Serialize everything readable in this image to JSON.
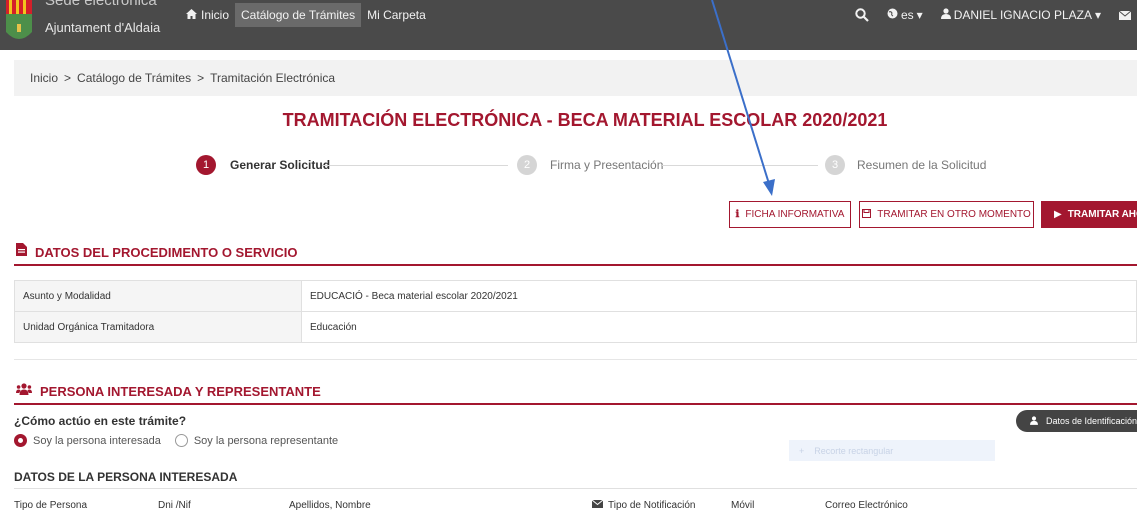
{
  "app": {
    "title": "Sede electrónica",
    "subtitle": "Ajuntament d'Aldaia"
  },
  "nav": {
    "links": [
      "Inicio",
      "Catálogo de Trámites",
      "Mi Carpeta"
    ],
    "language": "es",
    "user": "DANIEL IGNACIO PLAZA"
  },
  "breadcrumb": [
    "Inicio",
    ">",
    "Catálogo de Trámites",
    ">",
    "Tramitación Electrónica"
  ],
  "page_title": "TRAMITACIÓN ELECTRÓNICA - BECA MATERIAL ESCOLAR 2020/2021",
  "steps": [
    {
      "num": "1",
      "label": "Generar Solicitud",
      "active": true
    },
    {
      "num": "2",
      "label": "Firma y Presentación",
      "active": false
    },
    {
      "num": "3",
      "label": "Resumen de la Solicitud",
      "active": false
    }
  ],
  "actions": {
    "ficha": "FICHA INFORMATIVA",
    "otro_momento": "TRAMITAR EN OTRO MOMENTO",
    "ahora": "TRAMITAR AHORA"
  },
  "section_procedimiento": {
    "title": "DATOS DEL PROCEDIMENTO O SERVICIO",
    "rows": [
      {
        "label": "Asunto y Modalidad",
        "value": "EDUCACIÓ - Beca material escolar 2020/2021"
      },
      {
        "label": "Unidad Orgánica Tramitadora",
        "value": "Educación"
      }
    ]
  },
  "section_persona": {
    "title": "PERSONA INTERESADA Y REPRESENTANTE",
    "question": "¿Cómo actúo en este trámite?",
    "options": [
      "Soy la persona interesada",
      "Soy la persona representante"
    ],
    "selected": "Soy la persona interesada",
    "identify_button": "Datos de Identificación",
    "ghost_tool": "Recorte rectangular",
    "subheading": "DATOS DE LA PERSONA INTERESADA",
    "columns": [
      "Tipo de Persona",
      "Dni /Nif",
      "Apellidos, Nombre",
      "Tipo de Notificación",
      "Móvil",
      "Correo Electrónico"
    ]
  },
  "colors": {
    "brand": "#a3172f",
    "navbar": "#4a4a4a",
    "annotation_arrow": "#3b6fc9"
  },
  "icons": {
    "home": "home-icon",
    "search": "search-icon",
    "globe": "globe-icon",
    "user": "user-icon",
    "mail": "mail-icon",
    "document": "document-icon",
    "group": "group-icon",
    "info": "info-icon",
    "save": "save-icon",
    "play": "play-icon",
    "envelope": "envelope-icon"
  }
}
